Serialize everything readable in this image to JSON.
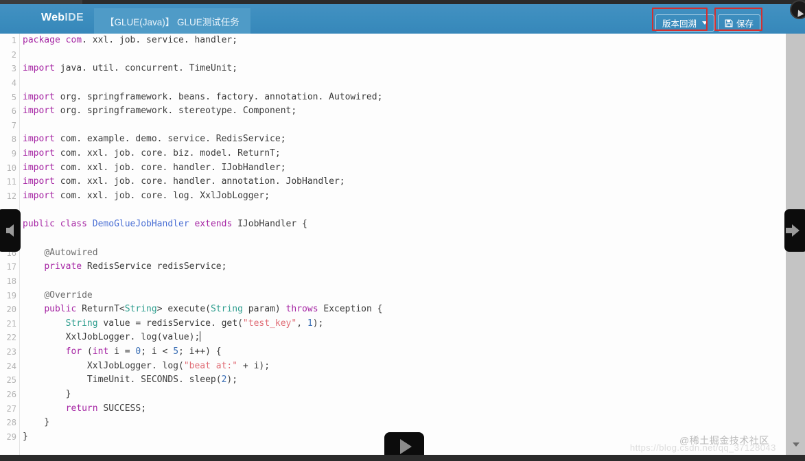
{
  "window": {
    "top_strip_color": "#2b2b2b",
    "bottom_bar_color": "#2b2b2b"
  },
  "header": {
    "background_color": "#3d8fc0",
    "logo_primary": "Web",
    "logo_secondary": "IDE",
    "tab": {
      "label": "【GLUE(Java)】 GLUE测试任务",
      "active": true
    },
    "buttons": [
      {
        "name": "version-rollback",
        "label": "版本回溯",
        "has_dropdown": true,
        "annotated": true,
        "annotation_color": "#d32f2f"
      },
      {
        "name": "save",
        "label": "保存",
        "icon": "floppy-disk-icon",
        "annotated": true,
        "annotation_color": "#d32f2f"
      }
    ],
    "cursor_badge": "mouse-cursor-icon"
  },
  "editor": {
    "language": "Java",
    "background_color": "#fdfdfd",
    "gutter_color": "#b3b3b3",
    "cursor_line": 22,
    "syntax_colors": {
      "keyword": "#a626a4",
      "type": "#2f9e8f",
      "classname": "#4a6fd4",
      "string": "#e06c75",
      "number": "#3b6fb5",
      "annotation": "#6d6d6d",
      "plain": "#3b3b3b"
    },
    "lines": [
      {
        "n": "1",
        "tokens": [
          {
            "t": "package",
            "c": "k"
          },
          {
            "t": " ",
            "c": ""
          },
          {
            "t": "com",
            "c": "k"
          },
          {
            "t": ". xxl. job. service. handler;",
            "c": ""
          }
        ]
      },
      {
        "n": "2",
        "tokens": []
      },
      {
        "n": "3",
        "tokens": [
          {
            "t": "import",
            "c": "k"
          },
          {
            "t": " java. util. concurrent. TimeUnit;",
            "c": ""
          }
        ]
      },
      {
        "n": "4",
        "tokens": []
      },
      {
        "n": "5",
        "tokens": [
          {
            "t": "import",
            "c": "k"
          },
          {
            "t": " org. springframework. beans. factory. annotation. Autowired;",
            "c": ""
          }
        ]
      },
      {
        "n": "6",
        "tokens": [
          {
            "t": "import",
            "c": "k"
          },
          {
            "t": " org. springframework. stereotype. Component;",
            "c": ""
          }
        ]
      },
      {
        "n": "7",
        "tokens": []
      },
      {
        "n": "8",
        "tokens": [
          {
            "t": "import",
            "c": "k"
          },
          {
            "t": " com. example. demo. service. RedisService;",
            "c": ""
          }
        ]
      },
      {
        "n": "9",
        "tokens": [
          {
            "t": "import",
            "c": "k"
          },
          {
            "t": " com. xxl. job. core. biz. model. ReturnT;",
            "c": ""
          }
        ]
      },
      {
        "n": "10",
        "tokens": [
          {
            "t": "import",
            "c": "k"
          },
          {
            "t": " com. xxl. job. core. handler. IJobHandler;",
            "c": ""
          }
        ]
      },
      {
        "n": "11",
        "tokens": [
          {
            "t": "import",
            "c": "k"
          },
          {
            "t": " com. xxl. job. core. handler. annotation. JobHandler;",
            "c": ""
          }
        ]
      },
      {
        "n": "12",
        "tokens": [
          {
            "t": "import",
            "c": "k"
          },
          {
            "t": " com. xxl. job. core. log. XxlJobLogger;",
            "c": ""
          }
        ]
      },
      {
        "n": "",
        "tokens": []
      },
      {
        "n": "",
        "tokens": [
          {
            "t": "public",
            "c": "k"
          },
          {
            "t": " ",
            "c": ""
          },
          {
            "t": "class",
            "c": "k"
          },
          {
            "t": " ",
            "c": ""
          },
          {
            "t": "DemoGlueJobHandler",
            "c": "cn"
          },
          {
            "t": " ",
            "c": ""
          },
          {
            "t": "extends",
            "c": "k"
          },
          {
            "t": " IJobHandler {",
            "c": ""
          }
        ]
      },
      {
        "n": "",
        "tokens": []
      },
      {
        "n": "16",
        "tokens": [
          {
            "t": "    ",
            "c": ""
          },
          {
            "t": "@Autowired",
            "c": "an"
          }
        ]
      },
      {
        "n": "17",
        "tokens": [
          {
            "t": "    ",
            "c": ""
          },
          {
            "t": "private",
            "c": "k"
          },
          {
            "t": " RedisService redisService;",
            "c": ""
          }
        ]
      },
      {
        "n": "18",
        "tokens": []
      },
      {
        "n": "19",
        "tokens": [
          {
            "t": "    ",
            "c": ""
          },
          {
            "t": "@Override",
            "c": "an"
          }
        ]
      },
      {
        "n": "20",
        "tokens": [
          {
            "t": "    ",
            "c": ""
          },
          {
            "t": "public",
            "c": "k"
          },
          {
            "t": " ReturnT<",
            "c": ""
          },
          {
            "t": "String",
            "c": "ty"
          },
          {
            "t": "> execute(",
            "c": ""
          },
          {
            "t": "String",
            "c": "ty"
          },
          {
            "t": " param) ",
            "c": ""
          },
          {
            "t": "throws",
            "c": "k"
          },
          {
            "t": " Exception {",
            "c": ""
          }
        ]
      },
      {
        "n": "21",
        "tokens": [
          {
            "t": "        ",
            "c": ""
          },
          {
            "t": "String",
            "c": "ty"
          },
          {
            "t": " value = redisService. get(",
            "c": ""
          },
          {
            "t": "\"test_key\"",
            "c": "st"
          },
          {
            "t": ", ",
            "c": ""
          },
          {
            "t": "1",
            "c": "nu"
          },
          {
            "t": ");",
            "c": ""
          }
        ]
      },
      {
        "n": "22",
        "tokens": [
          {
            "t": "        XxlJobLogger. log(value);",
            "c": ""
          }
        ],
        "cursor": true
      },
      {
        "n": "23",
        "tokens": [
          {
            "t": "        ",
            "c": ""
          },
          {
            "t": "for",
            "c": "k"
          },
          {
            "t": " (",
            "c": ""
          },
          {
            "t": "int",
            "c": "k"
          },
          {
            "t": " i = ",
            "c": ""
          },
          {
            "t": "0",
            "c": "nu"
          },
          {
            "t": "; i < ",
            "c": ""
          },
          {
            "t": "5",
            "c": "nu"
          },
          {
            "t": "; i++) {",
            "c": ""
          }
        ]
      },
      {
        "n": "24",
        "tokens": [
          {
            "t": "            XxlJobLogger. log(",
            "c": ""
          },
          {
            "t": "\"beat at:\"",
            "c": "st"
          },
          {
            "t": " + i);",
            "c": ""
          }
        ]
      },
      {
        "n": "25",
        "tokens": [
          {
            "t": "            TimeUnit. SECONDS. sleep(",
            "c": ""
          },
          {
            "t": "2",
            "c": "nu"
          },
          {
            "t": ");",
            "c": ""
          }
        ]
      },
      {
        "n": "26",
        "tokens": [
          {
            "t": "        }",
            "c": ""
          }
        ]
      },
      {
        "n": "27",
        "tokens": [
          {
            "t": "        ",
            "c": ""
          },
          {
            "t": "return",
            "c": "k"
          },
          {
            "t": " SUCCESS;",
            "c": ""
          }
        ]
      },
      {
        "n": "28",
        "tokens": [
          {
            "t": "    }",
            "c": ""
          }
        ]
      },
      {
        "n": "29",
        "tokens": [
          {
            "t": "}",
            "c": ""
          }
        ]
      }
    ]
  },
  "overlays": {
    "prev_nav": {
      "name": "previous-image-arrow",
      "icon": "arrow-left-icon"
    },
    "next_nav": {
      "name": "next-image-arrow",
      "icon": "arrow-right-icon"
    },
    "play": {
      "name": "play-button-overlay",
      "icon": "play-icon"
    }
  },
  "watermarks": {
    "brand": "@稀土掘金技术社区",
    "url": "https://blog.csdn.net/qq_37128043"
  }
}
